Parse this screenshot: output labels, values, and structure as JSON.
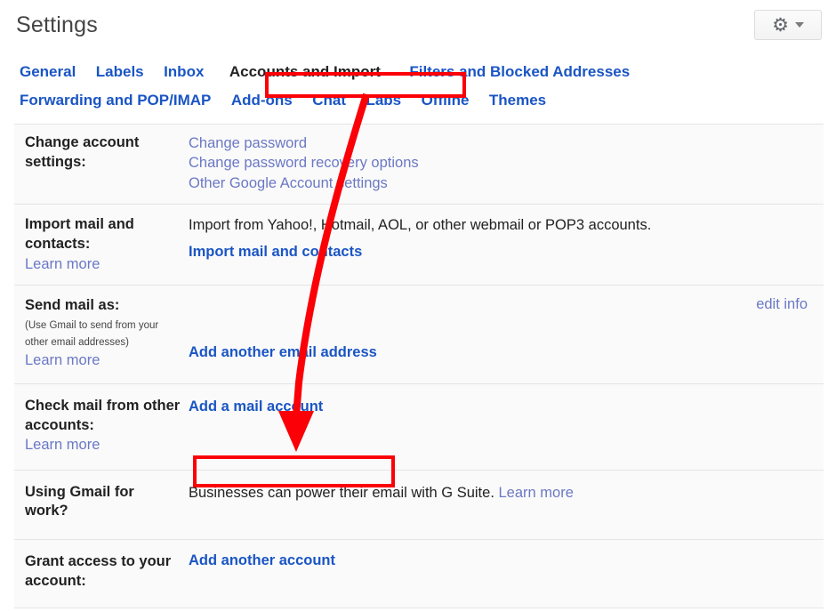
{
  "header": {
    "title": "Settings",
    "gear_icon": "gear-icon",
    "caret_icon": "chevron-down-icon"
  },
  "tabs": [
    {
      "label": "General",
      "selected": false
    },
    {
      "label": "Labels",
      "selected": false
    },
    {
      "label": "Inbox",
      "selected": false
    },
    {
      "label": "Accounts and Import",
      "selected": true
    },
    {
      "label": "Filters and Blocked Addresses",
      "selected": false
    },
    {
      "label": "Forwarding and POP/IMAP",
      "selected": false
    },
    {
      "label": "Add-ons",
      "selected": false
    },
    {
      "label": "Chat",
      "selected": false
    },
    {
      "label": "Labs",
      "selected": false
    },
    {
      "label": "Offline",
      "selected": false
    },
    {
      "label": "Themes",
      "selected": false
    }
  ],
  "rows": {
    "change_account": {
      "label": "Change account settings:",
      "links": [
        "Change password",
        "Change password recovery options",
        "Other Google Account settings"
      ]
    },
    "import_mail": {
      "label": "Import mail and contacts:",
      "learn_more": "Learn more",
      "description": "Import from Yahoo!, Hotmail, AOL, or other webmail or POP3 accounts.",
      "action": "Import mail and contacts"
    },
    "send_mail_as": {
      "label": "Send mail as:",
      "note": "(Use Gmail to send from your other email addresses)",
      "learn_more": "Learn more",
      "edit_info": "edit info",
      "action": "Add another email address"
    },
    "check_mail": {
      "label": "Check mail from other accounts:",
      "learn_more": "Learn more",
      "action": "Add a mail account"
    },
    "using_gmail": {
      "label": "Using Gmail for work?",
      "description": "Businesses can power their email with G Suite.",
      "learn_more": "Learn more"
    },
    "grant_access": {
      "label": "Grant access to your account:",
      "action": "Add another account"
    }
  },
  "annotations": {
    "highlight_color": "#fb0007",
    "box_tab_target": "Accounts and Import",
    "box_action_target": "Add a mail account",
    "arrow": "curved-arrow-from-accounts-tab-to-add-a-mail-account"
  }
}
